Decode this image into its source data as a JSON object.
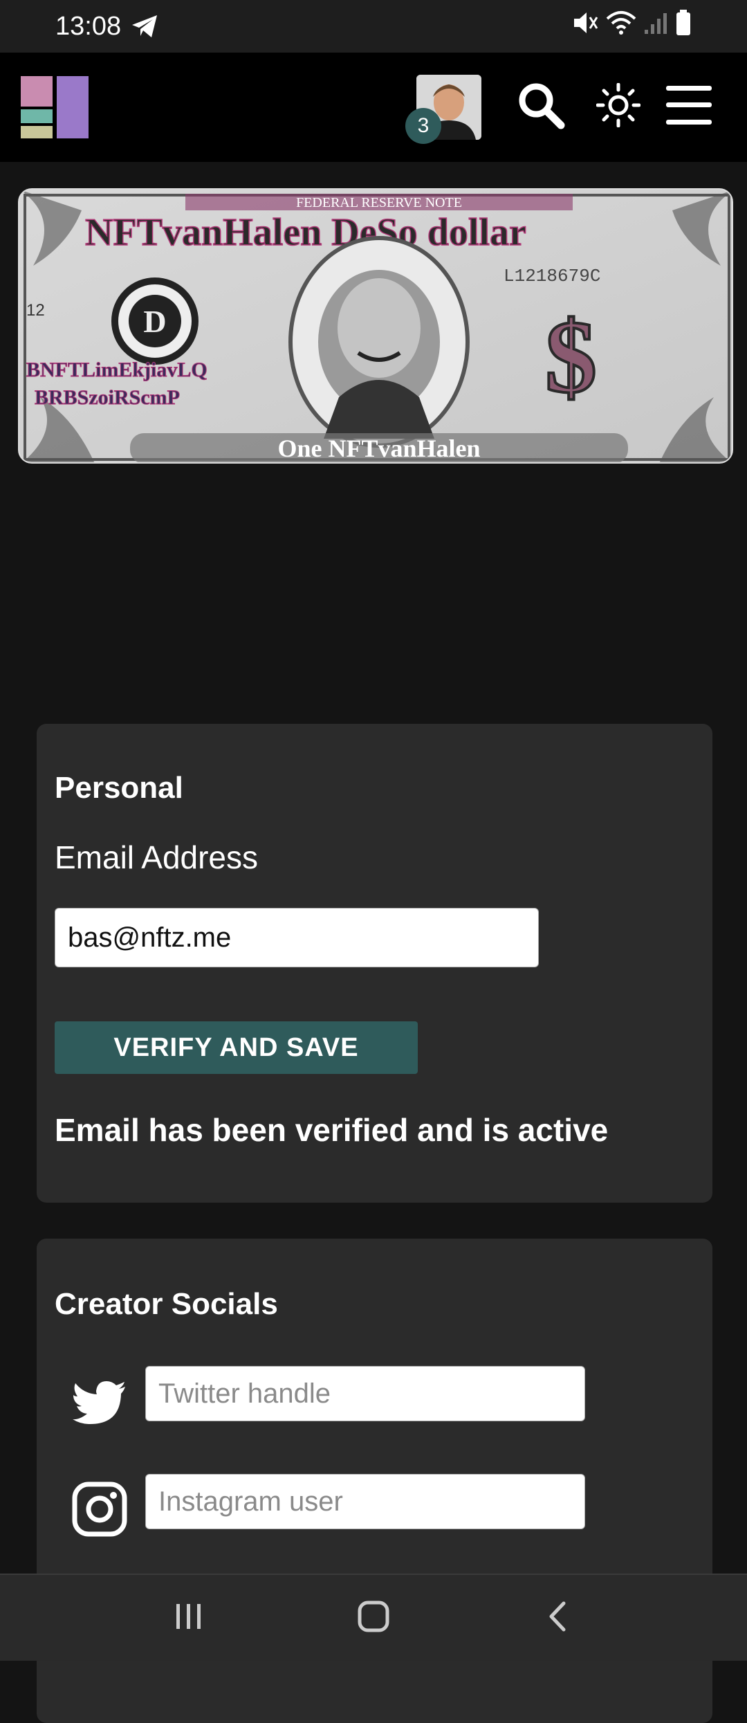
{
  "status_bar": {
    "time": "13:08",
    "icons": [
      "telegram-icon",
      "mute-icon",
      "wifi-icon",
      "signal-icon",
      "battery-icon"
    ]
  },
  "header": {
    "notification_count": "3",
    "icons": [
      "logo-icon",
      "avatar",
      "search-icon",
      "theme-toggle-icon",
      "menu-icon"
    ]
  },
  "banner": {
    "headline": "NFTvanHalen DeSo dollar",
    "top_text": "FEDERAL RESERVE NOTE",
    "serial": "L1218679C",
    "key_line1": "BNFTLimEkjiavLQ",
    "key_line2": "BRBSzoiRScmP",
    "bottom_text": "One NFTvanHalen",
    "corner_number": "12",
    "seal_letter": "D"
  },
  "personal": {
    "title": "Personal",
    "email_label": "Email Address",
    "email_value": "bas@nftz.me",
    "verify_button": "VERIFY AND SAVE",
    "status_message": "Email has been verified and is active"
  },
  "socials": {
    "title": "Creator Socials",
    "twitter_placeholder": "Twitter handle",
    "instagram_placeholder": "Instagram user"
  },
  "colors": {
    "accent": "#2f5b5b",
    "card": "#2b2b2b",
    "background": "#141414"
  }
}
